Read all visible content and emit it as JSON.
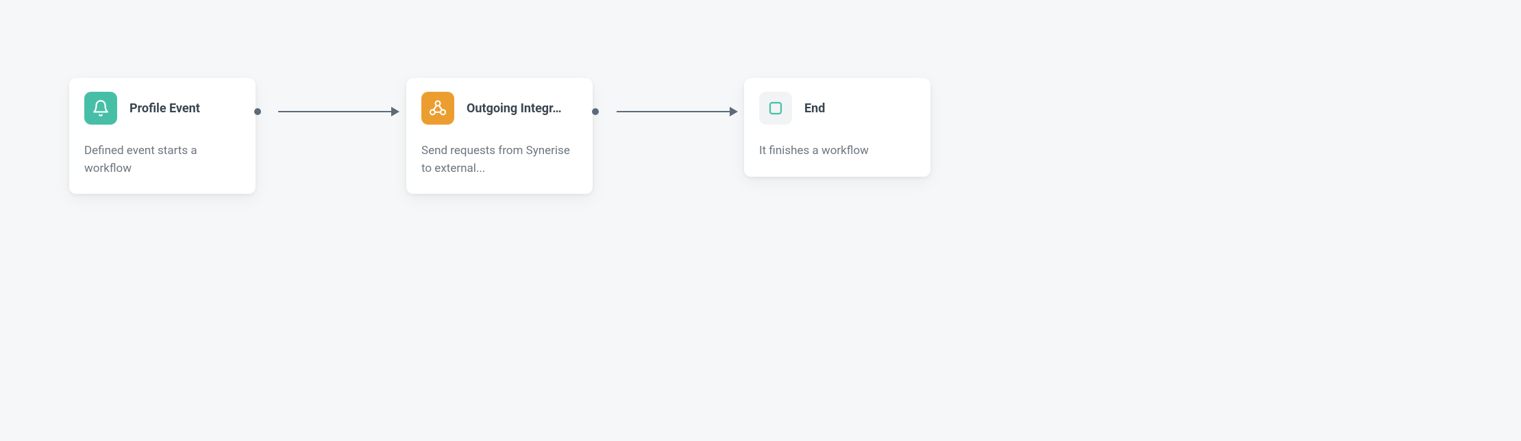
{
  "nodes": {
    "profile_event": {
      "title": "Profile Event",
      "description": "Defined event starts a workflow",
      "icon": "bell-icon",
      "icon_bg": "#47bfa7"
    },
    "outgoing_integration": {
      "title": "Outgoing Integr…",
      "description": "Send requests from Synerise to external...",
      "icon": "webhook-icon",
      "icon_bg": "#ec9d30"
    },
    "end": {
      "title": "End",
      "description": "It finishes a workflow",
      "icon": "stop-icon",
      "icon_bg": "#f1f3f4"
    }
  }
}
